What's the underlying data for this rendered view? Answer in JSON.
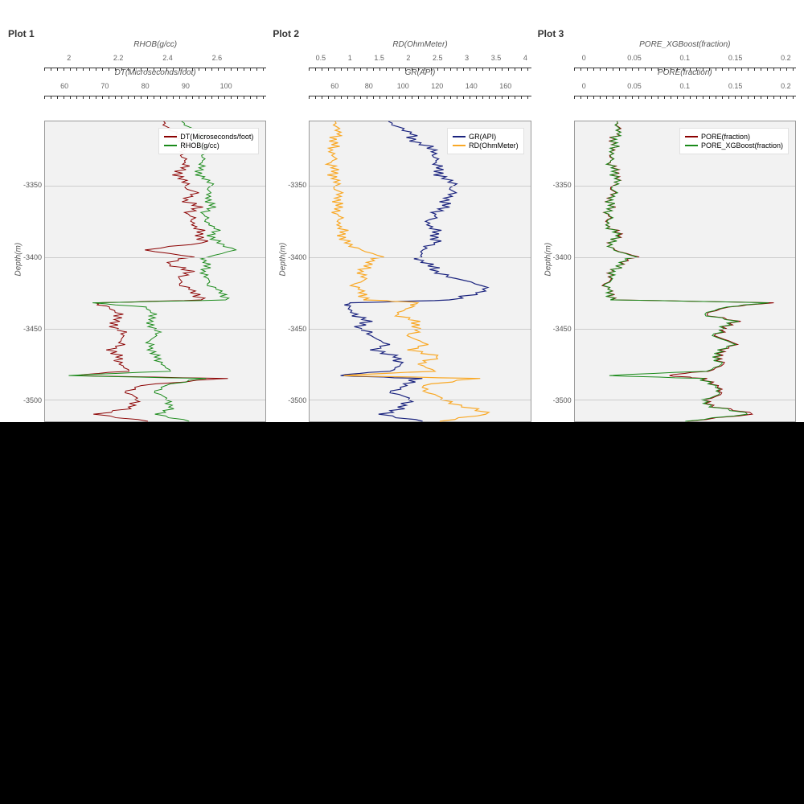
{
  "chart_data": [
    {
      "type": "line",
      "title": "Plot 1",
      "ylabel": "Depth(m)",
      "ylim": [
        -3515,
        -3305
      ],
      "y_ticks": [
        -3350,
        -3400,
        -3450,
        -3500
      ],
      "top_axes": [
        {
          "label": "RHOB(g/cc)",
          "ticks": [
            2,
            2.2,
            2.4,
            2.6
          ],
          "range": [
            1.9,
            2.8
          ]
        },
        {
          "label": "DT(Microseconds/foot)",
          "ticks": [
            60,
            70,
            80,
            90,
            100
          ],
          "range": [
            55,
            110
          ]
        }
      ],
      "series": [
        {
          "name": "DT(Microseconds/foot)",
          "color": "#8b0000",
          "axis": 1
        },
        {
          "name": "RHOB(g/cc)",
          "color": "#1a8a1a",
          "axis": 0
        }
      ],
      "depth": [
        -3305,
        -3310,
        -3315,
        -3320,
        -3325,
        -3330,
        -3335,
        -3340,
        -3345,
        -3350,
        -3355,
        -3360,
        -3365,
        -3370,
        -3375,
        -3380,
        -3385,
        -3390,
        -3395,
        -3400,
        -3405,
        -3410,
        -3415,
        -3420,
        -3425,
        -3430,
        -3432,
        -3435,
        -3440,
        -3445,
        -3450,
        -3455,
        -3460,
        -3465,
        -3470,
        -3475,
        -3480,
        -3483,
        -3485,
        -3490,
        -3495,
        -3500,
        -3505,
        -3510,
        -3515
      ],
      "DT": [
        84,
        86,
        88,
        90,
        90,
        89,
        91,
        88,
        89,
        90,
        92,
        90,
        93,
        91,
        92,
        93,
        94,
        94,
        80,
        91,
        85,
        92,
        88,
        90,
        92,
        95,
        68,
        70,
        74,
        72,
        73,
        75,
        74,
        72,
        73,
        74,
        75,
        62,
        100,
        78,
        76,
        78,
        77,
        68,
        80
      ],
      "RHOB": [
        2.45,
        2.5,
        2.55,
        2.52,
        2.56,
        2.54,
        2.55,
        2.52,
        2.55,
        2.58,
        2.56,
        2.57,
        2.58,
        2.55,
        2.56,
        2.6,
        2.58,
        2.6,
        2.68,
        2.55,
        2.56,
        2.55,
        2.56,
        2.58,
        2.62,
        2.65,
        2.1,
        2.3,
        2.35,
        2.32,
        2.35,
        2.36,
        2.32,
        2.34,
        2.35,
        2.38,
        2.4,
        1.98,
        2.55,
        2.38,
        2.36,
        2.4,
        2.42,
        2.36,
        2.48
      ]
    },
    {
      "type": "line",
      "title": "Plot 2",
      "ylabel": "Depth(m)",
      "ylim": [
        -3515,
        -3305
      ],
      "y_ticks": [
        -3350,
        -3400,
        -3450,
        -3500
      ],
      "top_axes": [
        {
          "label": "RD(OhmMeter)",
          "ticks": [
            0.5,
            1,
            1.5,
            2,
            2.5,
            3,
            3.5,
            4
          ],
          "range": [
            0.3,
            4.1
          ]
        },
        {
          "label": "GR(API)",
          "ticks": [
            60,
            80,
            100,
            120,
            140,
            160
          ],
          "range": [
            45,
            175
          ]
        }
      ],
      "series": [
        {
          "name": "GR(API)",
          "color": "#1a237e",
          "axis": 1
        },
        {
          "name": "RD(OhmMeter)",
          "color": "#f9a825",
          "axis": 0
        }
      ],
      "depth": [
        -3305,
        -3310,
        -3315,
        -3320,
        -3325,
        -3330,
        -3335,
        -3340,
        -3345,
        -3350,
        -3355,
        -3360,
        -3365,
        -3370,
        -3375,
        -3380,
        -3385,
        -3390,
        -3395,
        -3400,
        -3405,
        -3410,
        -3415,
        -3420,
        -3425,
        -3430,
        -3432,
        -3435,
        -3440,
        -3445,
        -3450,
        -3455,
        -3460,
        -3465,
        -3470,
        -3475,
        -3480,
        -3483,
        -3485,
        -3490,
        -3495,
        -3500,
        -3505,
        -3510,
        -3515
      ],
      "GR": [
        90,
        100,
        105,
        108,
        120,
        118,
        122,
        120,
        125,
        130,
        128,
        126,
        124,
        120,
        115,
        118,
        120,
        118,
        112,
        108,
        115,
        120,
        130,
        150,
        145,
        130,
        70,
        66,
        72,
        78,
        75,
        82,
        90,
        85,
        95,
        100,
        90,
        60,
        110,
        100,
        95,
        105,
        100,
        88,
        110
      ],
      "RD": [
        0.7,
        0.8,
        0.75,
        0.72,
        0.7,
        0.72,
        0.7,
        0.72,
        0.73,
        0.75,
        0.78,
        0.8,
        0.78,
        0.8,
        0.82,
        0.85,
        0.88,
        0.9,
        1.2,
        1.5,
        1.3,
        1.2,
        1.25,
        1.1,
        1.2,
        1.3,
        2.2,
        2.0,
        1.8,
        2.1,
        2.2,
        2.0,
        2.3,
        2.1,
        2.5,
        2.2,
        2.4,
        0.8,
        3.2,
        2.2,
        2.4,
        2.6,
        3.0,
        3.4,
        2.5
      ]
    },
    {
      "type": "line",
      "title": "Plot 3",
      "ylabel": "Depth(m)",
      "ylim": [
        -3515,
        -3305
      ],
      "y_ticks": [
        -3350,
        -3400,
        -3450,
        -3500
      ],
      "top_axes": [
        {
          "label": "PORE_XGBoost(fraction)",
          "ticks": [
            0,
            0.05,
            0.1,
            0.15,
            0.2
          ],
          "range": [
            -0.01,
            0.21
          ]
        },
        {
          "label": "PORE(fraction)",
          "ticks": [
            0,
            0.05,
            0.1,
            0.15,
            0.2
          ],
          "range": [
            -0.01,
            0.21
          ]
        }
      ],
      "series": [
        {
          "name": "PORE(fraction)",
          "color": "#8b0000",
          "axis": 1
        },
        {
          "name": "PORE_XGBoost(fraction)",
          "color": "#1a8a1a",
          "axis": 0
        }
      ],
      "depth": [
        -3305,
        -3310,
        -3315,
        -3320,
        -3325,
        -3330,
        -3335,
        -3340,
        -3345,
        -3350,
        -3355,
        -3360,
        -3365,
        -3370,
        -3375,
        -3380,
        -3385,
        -3390,
        -3395,
        -3400,
        -3405,
        -3410,
        -3415,
        -3420,
        -3425,
        -3430,
        -3432,
        -3435,
        -3440,
        -3445,
        -3450,
        -3455,
        -3460,
        -3465,
        -3470,
        -3475,
        -3480,
        -3483,
        -3485,
        -3490,
        -3495,
        -3500,
        -3505,
        -3510,
        -3515
      ],
      "PORE": [
        0.03,
        0.035,
        0.03,
        0.028,
        0.03,
        0.025,
        0.028,
        0.03,
        0.033,
        0.028,
        0.027,
        0.025,
        0.026,
        0.024,
        0.023,
        0.025,
        0.038,
        0.022,
        0.03,
        0.05,
        0.035,
        0.028,
        0.025,
        0.022,
        0.025,
        0.03,
        0.19,
        0.14,
        0.12,
        0.15,
        0.14,
        0.13,
        0.15,
        0.14,
        0.13,
        0.14,
        0.12,
        0.08,
        0.12,
        0.13,
        0.14,
        0.12,
        0.13,
        0.17,
        0.1
      ],
      "POREXGB": [
        0.03,
        0.034,
        0.031,
        0.029,
        0.029,
        0.026,
        0.027,
        0.029,
        0.032,
        0.029,
        0.028,
        0.026,
        0.025,
        0.025,
        0.024,
        0.024,
        0.036,
        0.023,
        0.029,
        0.048,
        0.034,
        0.029,
        0.026,
        0.023,
        0.024,
        0.029,
        0.185,
        0.138,
        0.118,
        0.148,
        0.138,
        0.128,
        0.148,
        0.138,
        0.128,
        0.138,
        0.118,
        0.02,
        0.118,
        0.128,
        0.138,
        0.118,
        0.128,
        0.165,
        0.098
      ]
    }
  ],
  "colors": {
    "dt": "#8b0000",
    "rhob": "#1a8a1a",
    "gr": "#1a237e",
    "rd": "#f9a825",
    "pore": "#8b0000",
    "porexgb": "#1a8a1a"
  },
  "legend_labels": {
    "p1a": "DT(Microseconds/foot)",
    "p1b": "RHOB(g/cc)",
    "p2a": "GR(API)",
    "p2b": "RD(OhmMeter)",
    "p3a": "PORE(fraction)",
    "p3b": "PORE_XGBoost(fraction)"
  }
}
